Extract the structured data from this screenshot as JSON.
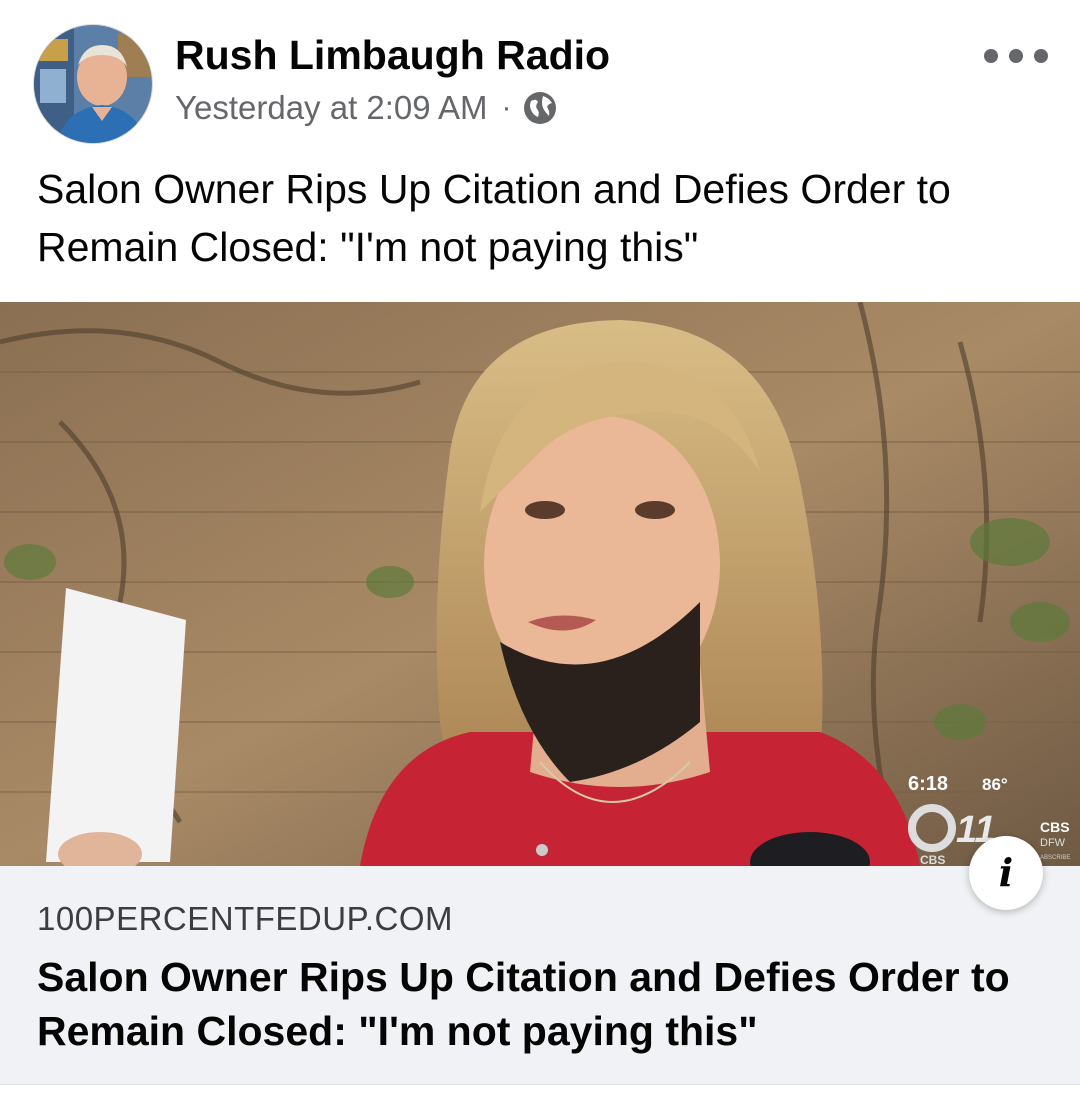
{
  "post": {
    "author": "Rush Limbaugh Radio",
    "timestamp": "Yesterday at 2:09 AM",
    "separator": "·",
    "privacy_icon": "globe-icon",
    "more_icon": "more-horizontal-icon",
    "text": "Salon Owner Rips Up Citation and Defies Order to Remain Closed: \"I'm not paying this\""
  },
  "media": {
    "bug": {
      "time": "6:18",
      "temp": "86°",
      "channel": "11",
      "network": "CBS",
      "network_sub": "CBS",
      "network_region": "DFW",
      "network_sub2": "ABSCRIBE"
    }
  },
  "link_card": {
    "domain": "100PERCENTFEDUP.COM",
    "title": "Salon Owner Rips Up Citation and Defies Order to Remain Closed: \"I'm not paying this\"",
    "info_icon": "info-icon",
    "info_glyph": "i"
  },
  "colors": {
    "meta_text": "#65676b",
    "card_bg": "#f0f2f5",
    "text": "#050505"
  }
}
